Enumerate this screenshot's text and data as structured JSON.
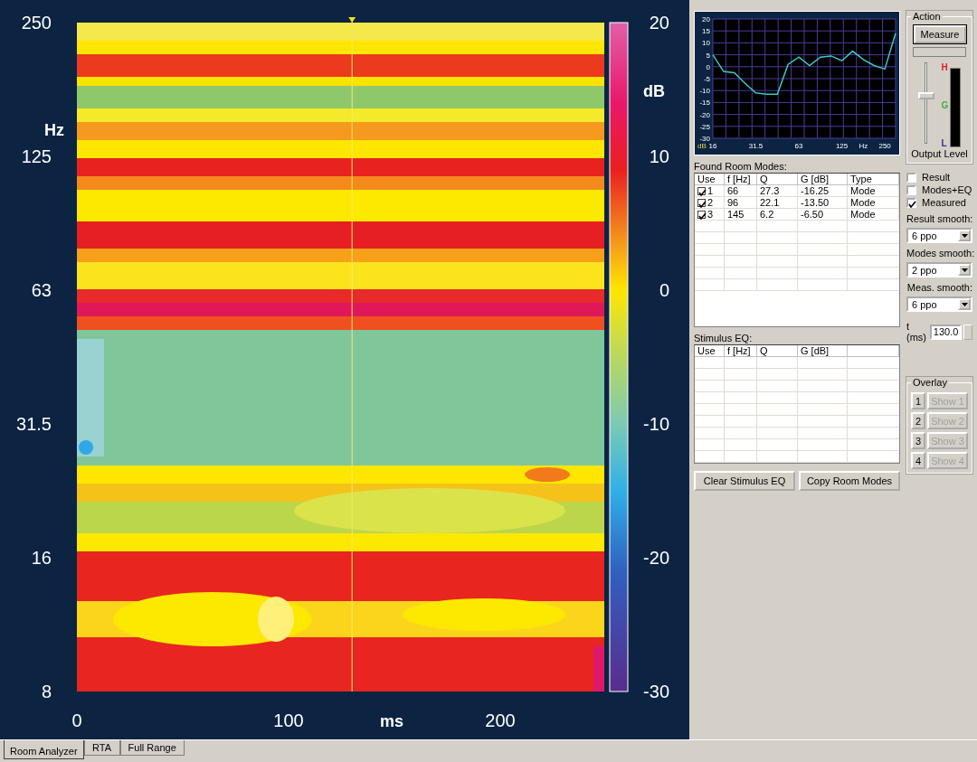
{
  "spectrogram": {
    "y_label": "Hz",
    "y_ticks": [
      "250",
      "125",
      "63",
      "31.5",
      "16",
      "8"
    ],
    "x_label": "ms",
    "x_ticks": [
      "0",
      "100",
      "200"
    ],
    "colorbar": {
      "unit": "dB",
      "ticks": [
        "20",
        "10",
        "0",
        "-10",
        "-20",
        "-30"
      ]
    }
  },
  "response_chart": {
    "chart_data": {
      "type": "line",
      "xlabel": "Hz",
      "ylabel": "dB",
      "categories": [
        "16",
        null,
        null,
        null,
        "31.5",
        null,
        null,
        null,
        "63",
        null,
        null,
        null,
        "125",
        null,
        null,
        null,
        "250",
        null
      ],
      "series": [
        {
          "color": "#3cc8c8",
          "values": [
            5,
            -2,
            -2.5,
            -7,
            -11,
            -11.5,
            -11.5,
            1,
            4,
            0.5,
            4,
            4.5,
            2.5,
            6.5,
            3,
            0.5,
            -1,
            14
          ]
        }
      ],
      "grid": true,
      "ylim": [
        -30,
        20
      ],
      "yticks": [
        20,
        15,
        10,
        5,
        0,
        -5,
        -10,
        -15,
        -20,
        -25,
        -30
      ]
    }
  },
  "action": {
    "title": "Action",
    "measure_button": "Measure",
    "progress": {
      "level": 0
    },
    "output_level": {
      "label": "Output Level",
      "level": 0.6
    },
    "meter_labels": [
      "H",
      "G",
      "L"
    ]
  },
  "found_room_modes": {
    "title": "Found Room Modes:",
    "columns": [
      "Use",
      "f [Hz]",
      "Q",
      "G [dB]",
      "Type"
    ],
    "rows": [
      {
        "checked": true,
        "number": "1",
        "f": "66",
        "q": "27.3",
        "g": "-16.25",
        "type": "Mode"
      },
      {
        "checked": true,
        "number": "2",
        "f": "96",
        "q": "22.1",
        "g": "-13.50",
        "type": "Mode"
      },
      {
        "checked": true,
        "number": "3",
        "f": "145",
        "q": "6.2",
        "g": "-6.50",
        "type": "Mode"
      }
    ]
  },
  "display_options": [
    {
      "label": "Result",
      "checked": false
    },
    {
      "label": "Modes+EQ",
      "checked": false
    },
    {
      "label": "Measured",
      "checked": true
    }
  ],
  "smoothing": [
    {
      "label": "Result smooth:",
      "value": "6 ppo"
    },
    {
      "label": "Modes smooth:",
      "value": "2 ppo"
    },
    {
      "label": "Meas. smooth:",
      "value": "6 ppo"
    }
  ],
  "time": {
    "label": "t (ms)",
    "value": "130.0"
  },
  "stimulus_eq": {
    "title": "Stimulus EQ:",
    "columns": [
      "Use",
      "f [Hz]",
      "Q",
      "G [dB]"
    ]
  },
  "buttons": [
    "Clear Stimulus EQ",
    "Copy Room Modes"
  ],
  "overlay": {
    "title": "Overlay",
    "slots": [
      {
        "number": "1",
        "show_label": "Show 1",
        "disabled": true
      },
      {
        "number": "2",
        "show_label": "Show 2",
        "disabled": true
      },
      {
        "number": "3",
        "show_label": "Show 3",
        "disabled": true
      },
      {
        "number": "4",
        "show_label": "Show 4",
        "disabled": true
      }
    ]
  },
  "tabs": [
    {
      "label": "Room Analyzer",
      "selected": true
    },
    {
      "label": "RTA",
      "selected": false
    },
    {
      "label": "Full Range",
      "selected": false
    }
  ]
}
